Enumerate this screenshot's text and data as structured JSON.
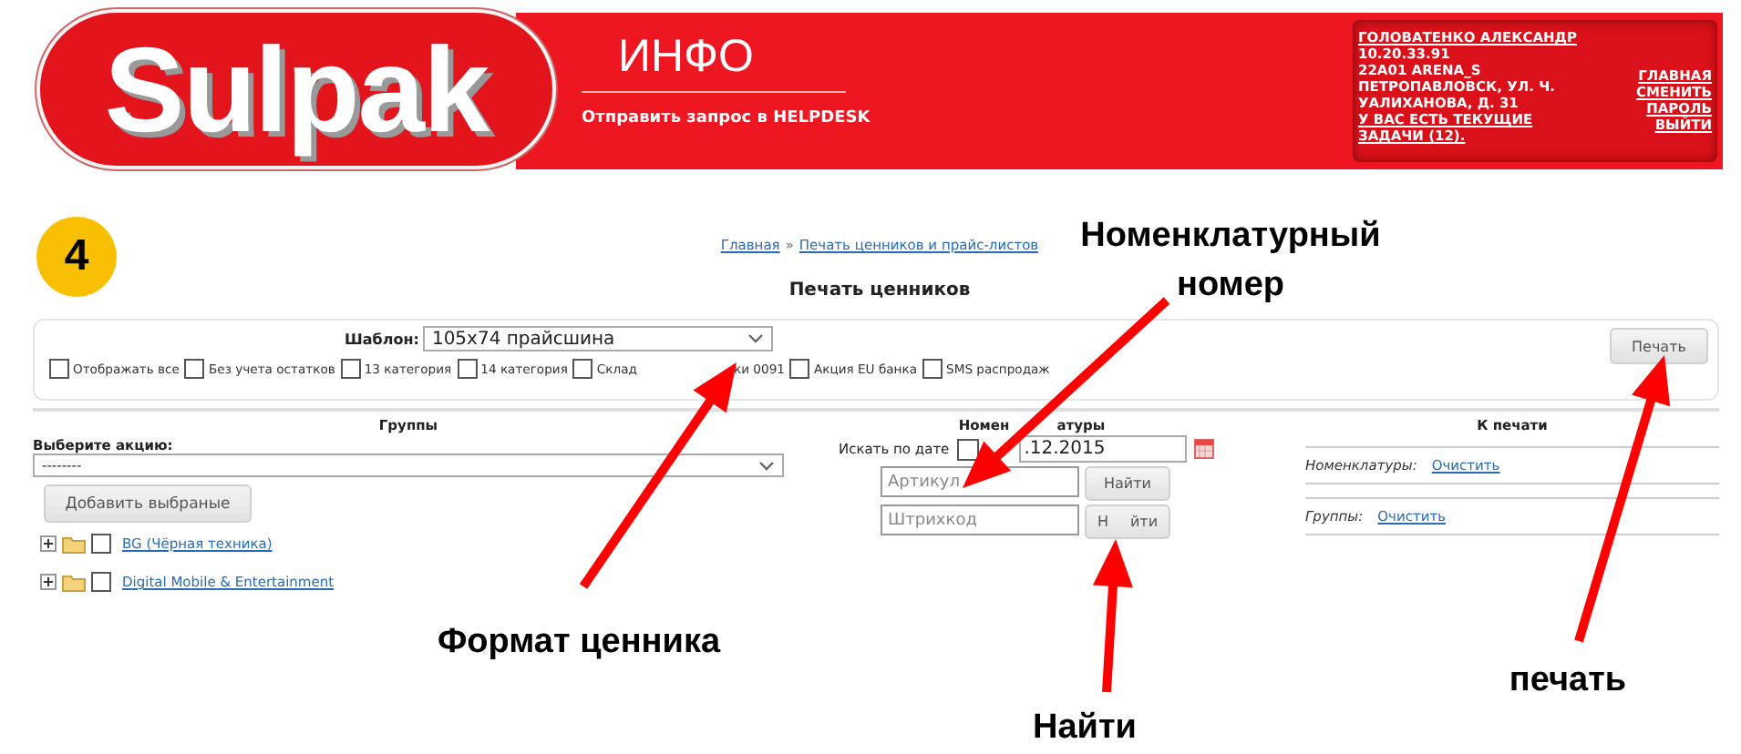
{
  "header": {
    "logo": "Sulpak",
    "title": "ИНФО",
    "helpdesk_link": "Отправить запрос в HELPDESK",
    "user_lines": [
      {
        "text": "ГОЛОВАТЕНКО АЛЕКСАНДР",
        "link": true
      },
      {
        "text": "10.20.33.91",
        "link": false
      },
      {
        "text": "22A01 ARENA_S",
        "link": false
      },
      {
        "text": "ПЕТРОПАВЛОВСК, УЛ. Ч.",
        "link": false
      },
      {
        "text": "УАЛИХАНОВА, Д. 31",
        "link": false
      },
      {
        "text": "У ВАС ЕСТЬ ТЕКУЩИЕ ЗАДАЧИ (12).",
        "link": true
      }
    ],
    "user_links": [
      "ГЛАВНАЯ",
      "СМЕНИТЬ ПАРОЛЬ",
      "ВЫЙТИ"
    ]
  },
  "step_badge": "4",
  "breadcrumb": {
    "items": [
      "Главная",
      "Печать ценников и прайс-листов"
    ],
    "separator": "»"
  },
  "page_title": "Печать ценников",
  "template": {
    "label": "Шаблон:",
    "value": "105x74 прайсшина"
  },
  "filters": [
    {
      "label": "Отображать все",
      "checked": false
    },
    {
      "label": "Без учета остатков",
      "checked": false
    },
    {
      "label": "13 категория",
      "checked": false
    },
    {
      "label": "14 категория",
      "checked": false
    },
    {
      "label": "Склад",
      "after_gap": "ки 0091",
      "checked": false
    },
    {
      "label": "Акция EU банка",
      "checked": false
    },
    {
      "label": "SMS распродаж",
      "checked": false
    }
  ],
  "print_button": "Печать",
  "groups": {
    "heading": "Группы",
    "promo_label": "Выберите акцию:",
    "promo_value": "--------",
    "add_button": "Добавить выбраные",
    "tree": [
      {
        "label": "BG (Чёрная техника)",
        "checked": false
      },
      {
        "label": "Digital Mobile & Entertainment",
        "checked": false
      }
    ]
  },
  "nomenclatures": {
    "heading": "Номен",
    "heading_after_gap": "атуры",
    "date_label": "Искать по дате",
    "date_checked": false,
    "date_value": ".12.2015",
    "searches": [
      {
        "placeholder": "Артикул",
        "button": "Найти"
      },
      {
        "placeholder": "Штрихкод",
        "button": "Н",
        "button_after_gap": "йти"
      }
    ]
  },
  "to_print": {
    "heading": "К печати",
    "rows": [
      {
        "label": "Номенклатуры:",
        "link": "Очистить"
      },
      {
        "label": "Группы:",
        "link": "Очистить"
      }
    ]
  },
  "annotations": [
    {
      "lines": [
        "Номенклатурный",
        "номер"
      ]
    },
    {
      "lines": [
        "Формат ценника"
      ]
    },
    {
      "lines": [
        "Найти"
      ]
    },
    {
      "lines": [
        "печать"
      ]
    }
  ]
}
